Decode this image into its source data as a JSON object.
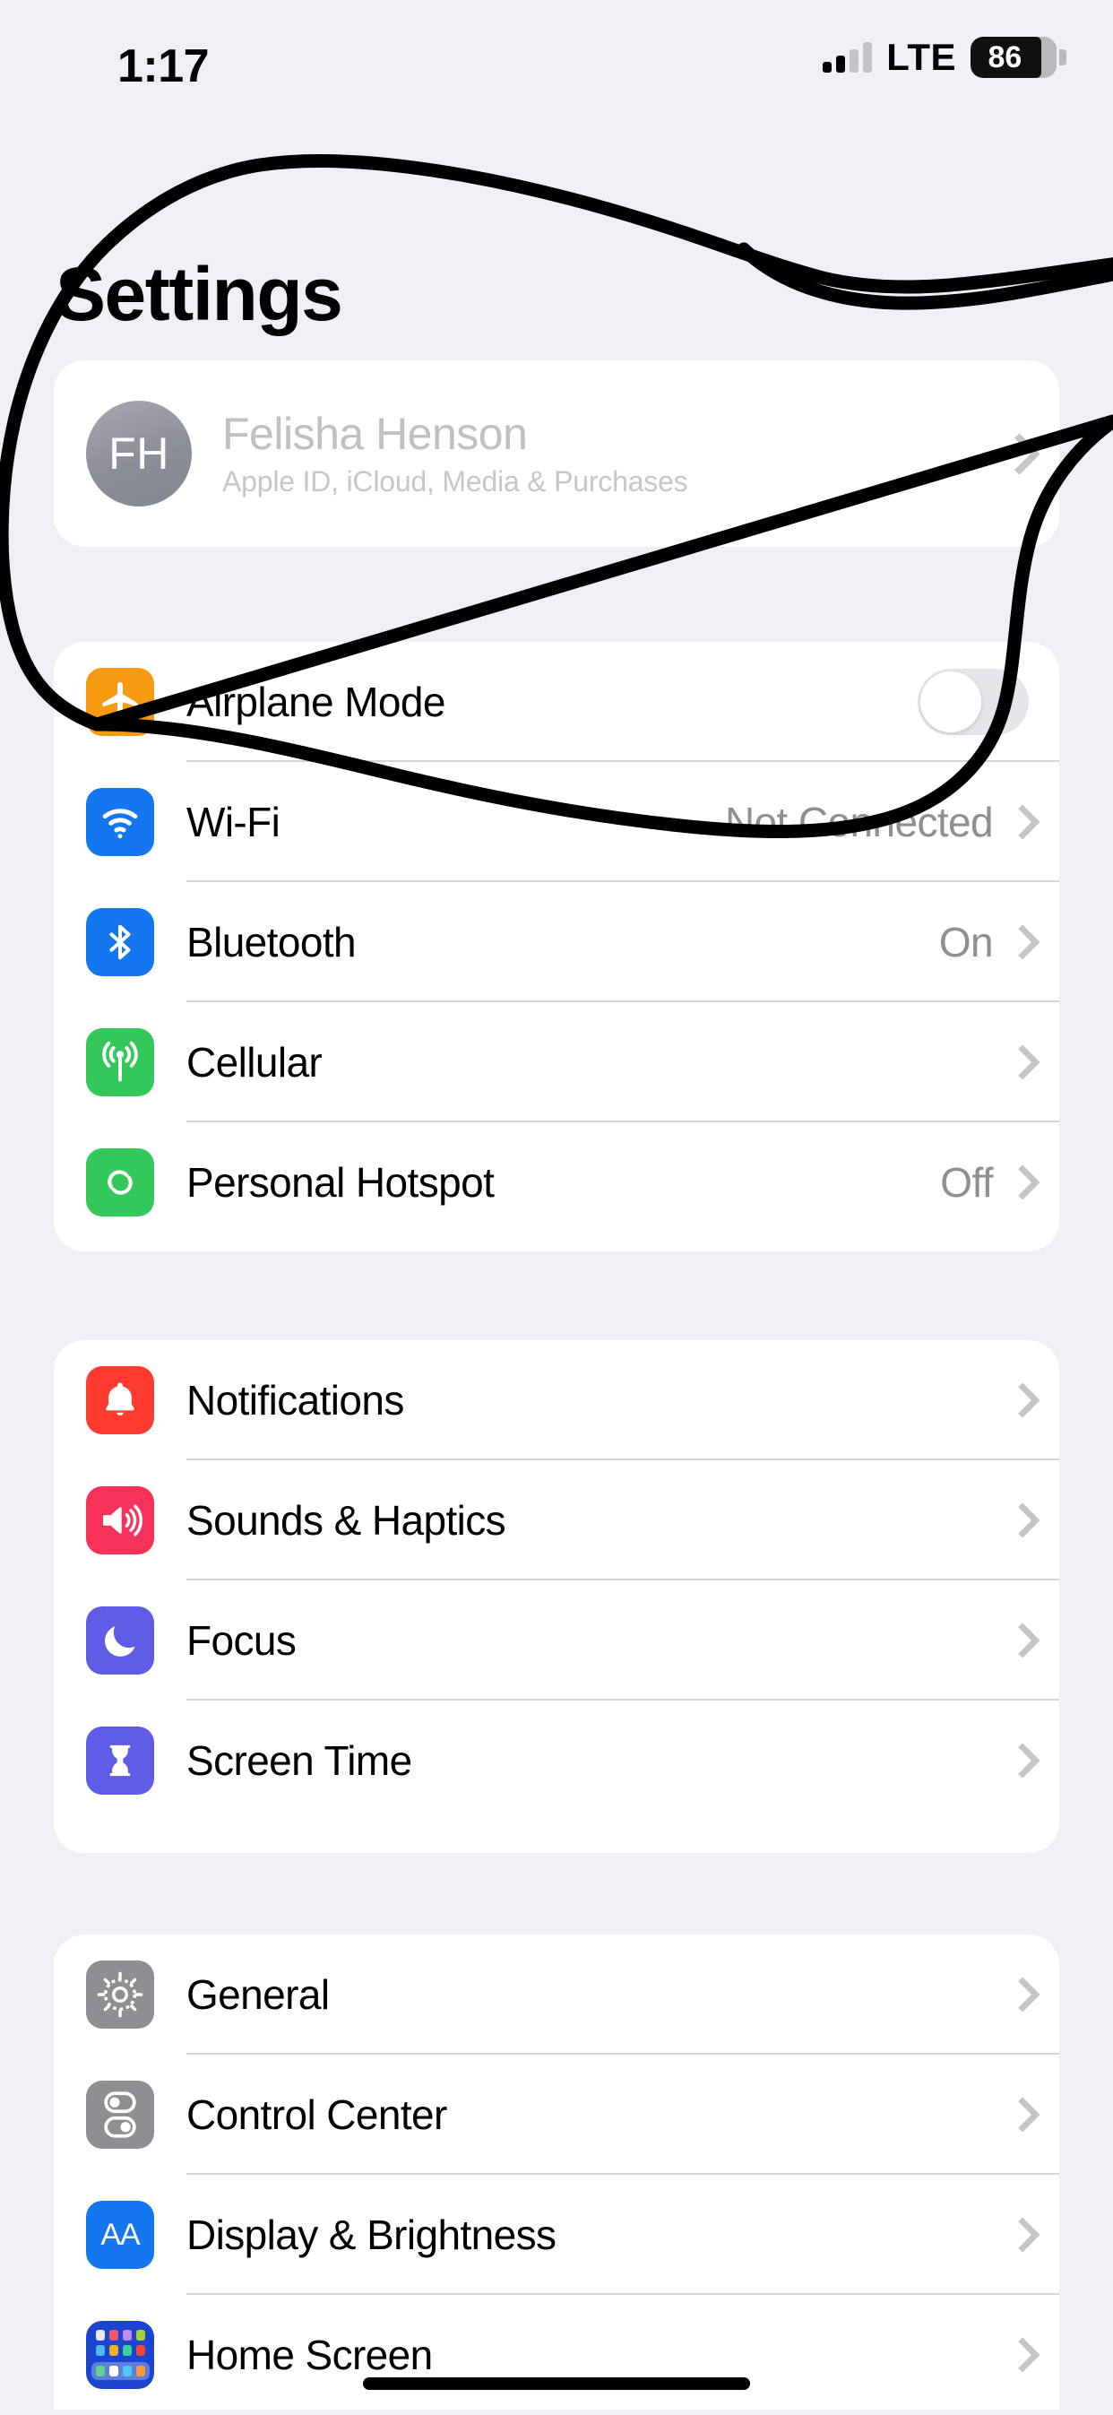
{
  "status_bar": {
    "time": "1:17",
    "carrier": "LTE",
    "battery_percent": "86",
    "signal_icon": "cellular-signal-bars-icon",
    "battery_icon": "battery-icon"
  },
  "header": {
    "title": "Settings"
  },
  "profile": {
    "initials": "FH",
    "name": "Felisha Henson",
    "subtitle": "Apple ID, iCloud, Media & Purchases",
    "chevron_icon": "chevron-right-icon",
    "avatar_icon": "avatar"
  },
  "groups": [
    {
      "id": "connectivity",
      "rows": [
        {
          "label": "Airplane Mode",
          "value": "",
          "icon": "airplane-icon",
          "icon_color": "#F59A11",
          "control": "toggle",
          "toggle_on": false
        },
        {
          "label": "Wi-Fi",
          "value": "Not Connected",
          "icon": "wifi-icon",
          "icon_color": "#1477F0",
          "control": "chevron"
        },
        {
          "label": "Bluetooth",
          "value": "On",
          "icon": "bluetooth-icon",
          "icon_color": "#1477F0",
          "control": "chevron"
        },
        {
          "label": "Cellular",
          "value": "",
          "icon": "cellular-antenna-icon",
          "icon_color": "#34C759",
          "control": "chevron"
        },
        {
          "label": "Personal Hotspot",
          "value": "Off",
          "icon": "personal-hotspot-icon",
          "icon_color": "#34C759",
          "control": "chevron"
        }
      ]
    },
    {
      "id": "alerts",
      "rows": [
        {
          "label": "Notifications",
          "value": "",
          "icon": "bell-icon",
          "icon_color": "#FF3B30",
          "control": "chevron"
        },
        {
          "label": "Sounds & Haptics",
          "value": "",
          "icon": "speaker-icon",
          "icon_color": "#F6315A",
          "control": "chevron"
        },
        {
          "label": "Focus",
          "value": "",
          "icon": "moon-icon",
          "icon_color": "#5E5CE6",
          "control": "chevron"
        },
        {
          "label": "Screen Time",
          "value": "",
          "icon": "hourglass-icon",
          "icon_color": "#5E5CE6",
          "control": "chevron"
        }
      ]
    },
    {
      "id": "system",
      "rows": [
        {
          "label": "General",
          "value": "",
          "icon": "gear-icon",
          "icon_color": "#8E8E93",
          "control": "chevron"
        },
        {
          "label": "Control Center",
          "value": "",
          "icon": "control-center-icon",
          "icon_color": "#8E8E93",
          "control": "chevron"
        },
        {
          "label": "Display & Brightness",
          "value": "",
          "icon": "display-aa-icon",
          "icon_color": "#1477F0",
          "control": "chevron"
        },
        {
          "label": "Home Screen",
          "value": "",
          "icon": "home-screen-grid-icon",
          "icon_color": "#1B45CE",
          "control": "chevron"
        }
      ]
    }
  ],
  "annotation": {
    "type": "hand-drawn-circle",
    "color": "#000000",
    "stroke_width": 15
  },
  "home_indicator": {
    "icon": "home-indicator"
  }
}
